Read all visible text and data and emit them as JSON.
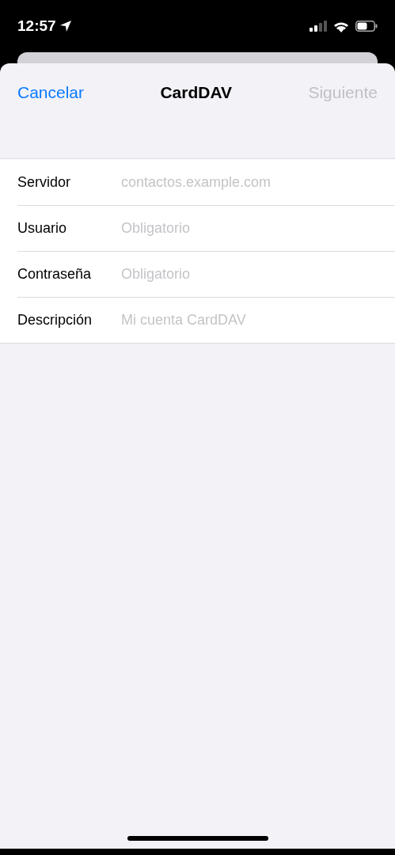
{
  "status_bar": {
    "time": "12:57"
  },
  "nav": {
    "cancel": "Cancelar",
    "title": "CardDAV",
    "next": {
      "label": "Siguiente",
      "disabled": true
    }
  },
  "fields": [
    {
      "label": "Servidor",
      "placeholder": "contactos.example.com"
    },
    {
      "label": "Usuario",
      "placeholder": "Obligatorio"
    },
    {
      "label": "Contraseña",
      "placeholder": "Obligatorio"
    },
    {
      "label": "Descripción",
      "placeholder": "Mi cuenta CardDAV"
    }
  ]
}
